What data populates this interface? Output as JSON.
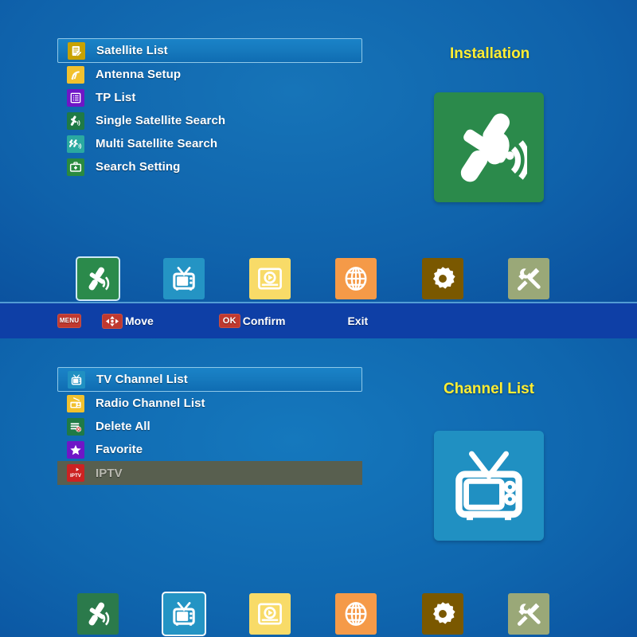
{
  "theme": {
    "bg_blue": "#0f62ab",
    "statusbar_blue": "#0e3fa6",
    "title_yellow": "#ffee33",
    "key_red": "#c0392f",
    "selected_blue": "#1679bd",
    "disabled_gray": "#585f4f"
  },
  "panel_installation": {
    "title": "Installation",
    "tile": {
      "icon": "satellite-dish-icon",
      "color": "#2b8a4b"
    },
    "menu": [
      {
        "label": "Satellite List",
        "icon": "satellite-list-icon",
        "icon_color": "#c8a200",
        "selected": true,
        "disabled": false
      },
      {
        "label": "Antenna Setup",
        "icon": "antenna-setup-icon",
        "icon_color": "#f2c12e",
        "selected": false,
        "disabled": false
      },
      {
        "label": "TP List",
        "icon": "tp-list-icon",
        "icon_color": "#6f16c7",
        "selected": false,
        "disabled": false
      },
      {
        "label": "Single Satellite Search",
        "icon": "single-search-icon",
        "icon_color": "#1f7a46",
        "selected": false,
        "disabled": false
      },
      {
        "label": "Multi Satellite Search",
        "icon": "multi-search-icon",
        "icon_color": "#2aa9a0",
        "selected": false,
        "disabled": false
      },
      {
        "label": "Search Setting",
        "icon": "search-setting-icon",
        "icon_color": "#2a8a3f",
        "selected": false,
        "disabled": false
      }
    ],
    "iconstrip": [
      {
        "name": "installation-icon",
        "color": "#2b8a4b",
        "glyph": "satellite",
        "active": true
      },
      {
        "name": "channel-list-icon",
        "color": "#2494c4",
        "glyph": "tv",
        "active": false
      },
      {
        "name": "media-player-icon",
        "color": "#f8db68",
        "glyph": "player",
        "active": false
      },
      {
        "name": "network-icon",
        "color": "#f59a48",
        "glyph": "globe",
        "active": false
      },
      {
        "name": "system-setup-icon",
        "color": "#7a5800",
        "glyph": "gear",
        "active": false
      },
      {
        "name": "tools-icon",
        "color": "#9aa878",
        "glyph": "tools",
        "active": false
      }
    ]
  },
  "statusbar": {
    "items": [
      {
        "key": "dpad",
        "key_label": "",
        "label": "Move"
      },
      {
        "key": "ok",
        "key_label": "OK",
        "label": "Confirm"
      },
      {
        "key": "menu",
        "key_label": "MENU",
        "label": "Exit"
      }
    ]
  },
  "panel_channel": {
    "title": "Channel List",
    "tile": {
      "icon": "tv-icon",
      "color": "#2090c2"
    },
    "menu": [
      {
        "label": "TV Channel List",
        "icon": "tv-channel-icon",
        "icon_color": "#2090c2",
        "selected": true,
        "disabled": false
      },
      {
        "label": "Radio Channel List",
        "icon": "radio-channel-icon",
        "icon_color": "#f2c12e",
        "selected": false,
        "disabled": false
      },
      {
        "label": "Delete All",
        "icon": "delete-all-icon",
        "icon_color": "#1f7a46",
        "selected": false,
        "disabled": false
      },
      {
        "label": "Favorite",
        "icon": "favorite-star-icon",
        "icon_color": "#6f16c7",
        "selected": false,
        "disabled": false
      },
      {
        "label": "IPTV",
        "icon": "iptv-icon",
        "icon_color": "#cc2222",
        "selected": false,
        "disabled": true
      }
    ],
    "iconstrip": [
      {
        "name": "installation-icon",
        "color": "#2b7a4b",
        "glyph": "satellite",
        "active": false
      },
      {
        "name": "channel-list-icon",
        "color": "#2494c4",
        "glyph": "tv",
        "active": true
      },
      {
        "name": "media-player-icon",
        "color": "#f8db68",
        "glyph": "player",
        "active": false
      },
      {
        "name": "network-icon",
        "color": "#f59a48",
        "glyph": "globe",
        "active": false
      },
      {
        "name": "system-setup-icon",
        "color": "#7a5800",
        "glyph": "gear",
        "active": false
      },
      {
        "name": "tools-icon",
        "color": "#9aa878",
        "glyph": "tools",
        "active": false
      }
    ]
  }
}
